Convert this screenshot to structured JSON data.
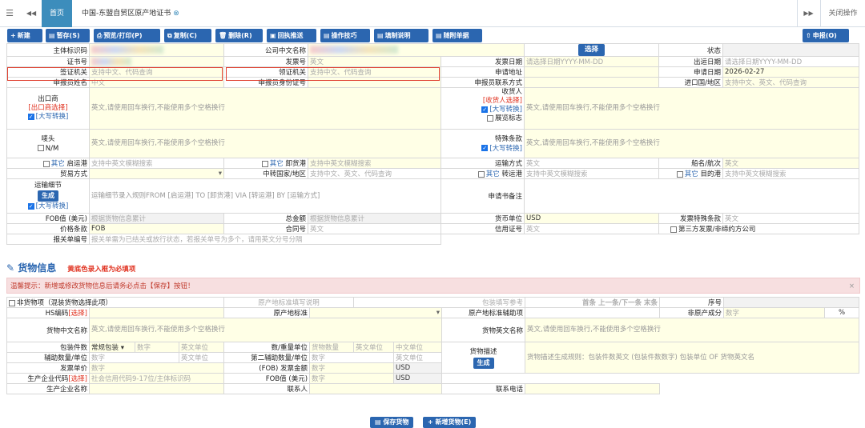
{
  "tabbar": {
    "menu_icon": "☰",
    "prev_icon": "◀◀",
    "next_icon": "▶▶",
    "home": "首页",
    "active_tab": "中国-东盟自贸区原产地证书",
    "close_other": "关闭操作"
  },
  "toolbar": {
    "buttons": [
      {
        "icon": "+",
        "label": "新建"
      },
      {
        "icon": "▤",
        "label": "暂存(S)"
      },
      {
        "icon": "⎙",
        "label": "预览/打印(P)"
      },
      {
        "icon": "⧉",
        "label": "复制(C)"
      },
      {
        "icon": "🗑",
        "label": "删除(R)"
      },
      {
        "icon": "▣",
        "label": "回执推送"
      },
      {
        "icon": "▤",
        "label": "操作技巧"
      },
      {
        "icon": "▤",
        "label": "填制说明"
      },
      {
        "icon": "▤",
        "label": "随附单据"
      }
    ],
    "declare": {
      "icon": "⇧",
      "label": "申报(O)"
    }
  },
  "form": {
    "main_code": "主体标识码",
    "cn_name": "公司中文名称",
    "select_btn": "选择",
    "status": "状态",
    "cert_no": "证书号",
    "invoice_no": "发票号",
    "invoice_ph": "英文",
    "invoice_date": "发票日期",
    "invoice_date_ph": "请选择日期YYYY-MM-DD",
    "export_date": "出运日期",
    "export_date_ph": "请选择日期YYYY-MM-DD",
    "issuing": "签证机关",
    "issuing_ph": "支持中文、代码查询",
    "receiving": "领证机关",
    "receiving_ph": "支持中文、代码查询",
    "apply_addr": "申请地址",
    "apply_date": "申请日期",
    "apply_date_val": "2026-02-27",
    "decl_name": "申报员姓名",
    "decl_name_ph": "中文",
    "decl_id": "申报员身份证号",
    "decl_contact": "申报员联系方式",
    "import_country": "进口国/地区",
    "import_country_ph": "支持中文、英文、代码查询",
    "exporter": "出口商",
    "exporter_select": "[出口商选择]",
    "upper": "[大写转换]",
    "multiline_ph": "英文,请使用回车换行,不能使用多个空格换行",
    "consignee": "收货人",
    "consignee_select": "[收货人选择]",
    "show_flag": "展览标志",
    "mark": "唛头",
    "nm": "N/M",
    "special": "特殊条款",
    "other": "其它",
    "load_port": "启运港",
    "port_ph": "支持中英文模糊搜索",
    "unload_port": "卸货港",
    "transport": "运输方式",
    "transport_ph": "英文",
    "vessel": "船名/航次",
    "vessel_ph": "英文",
    "trade_mode": "贸易方式",
    "transit_country": "中转国家/地区",
    "transit_ph": "支持中文、英文、代码查询",
    "transit_port": "转运港",
    "dest_port": "目的港",
    "transport_detail": "运输细节",
    "transport_detail_ph": "运输细节录入规则FROM [启运港] TO [卸货港] VIA [转运港] BY [运输方式]",
    "generate": "生成",
    "remark": "申请书备注",
    "fob": "FOB值 (美元)",
    "fob_ph": "根据货物信息累计",
    "total": "总金额",
    "total_ph": "根据货物信息累计",
    "currency": "货币单位",
    "currency_val": "USD",
    "invoice_special": "发票特殊条款",
    "invoice_special_ph": "英文",
    "price_terms": "价格条款",
    "price_terms_val": "FOB",
    "contract": "合同号",
    "contract_ph": "英文",
    "credit": "信用证号",
    "credit_ph": "英文",
    "third_party": "第三方发票/非缔约方公司",
    "customs_no": "报关单编号",
    "customs_ph": "报关单需为已结关或放行状态，若报关单号为多个，请用英文分号分隔"
  },
  "goods": {
    "title": "货物信息",
    "required_note": "黄底色录入框为必填项",
    "warning": "温馨提示：新增或修改货物信息后请务必点击【保存】按钮！",
    "non_goods": "非货物项（混装货物选择此项）",
    "origin_link": "原产地标准填写说明",
    "pack_link": "包装填写参考",
    "nav": "首条 上一条/下一条 末条",
    "seq": "序号",
    "hs": "HS编码",
    "hs_select": "[选择]",
    "origin_std": "原产地标准",
    "origin_aux": "原产地标准辅助项",
    "non_origin": "非原产成分",
    "non_origin_ph": "数字",
    "percent": "%",
    "cn_desc": "货物中文名称",
    "en_desc": "货物英文名称",
    "desc_ph": "英文,请使用回车换行,不能使用多个空格换行",
    "pack_count": "包装件数",
    "pack_type": "常规包装",
    "num_ph": "数字",
    "unit_en": "英文单位",
    "qty_weight": "数/重量单位",
    "qty_ph": "货物数量",
    "cn_unit": "中文单位",
    "aux_qty": "辅助数量/单位",
    "aux_qty2": "第二辅助数量/单位",
    "goods_desc": "货物描述",
    "goods_desc_ph": "货物描述生成规则：包装件数英文 (包装件数数字) 包装单位 OF 货物英文名",
    "invoice_price": "发票单价",
    "fob_invoice": "(FOB) 发票金额",
    "usd": "USD",
    "producer_code": "生产企业代码",
    "producer_select": "[选择]",
    "producer_ph": "社会信用代码9-17位/主体标识码",
    "fob_usd": "FOB值 (美元)",
    "producer_name": "生产企业名称",
    "contact": "联系人",
    "phone": "联系电话"
  },
  "bottom": {
    "save": "保存货物",
    "add": "新增货物(E)"
  }
}
